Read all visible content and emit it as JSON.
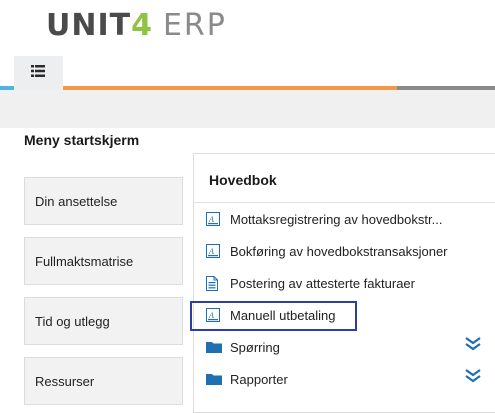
{
  "header": {
    "logo_brand": "UNIT",
    "logo_four": "4",
    "logo_product": "ERP"
  },
  "tabs": {
    "menu_icon": "list-icon"
  },
  "page": {
    "title": "Meny startskjerm"
  },
  "sidebar": {
    "items": [
      {
        "label": "Din ansettelse"
      },
      {
        "label": "Fullmaktsmatrise"
      },
      {
        "label": "Tid og utlegg"
      },
      {
        "label": "Ressurser"
      }
    ]
  },
  "card": {
    "title": "Hovedbok",
    "items": [
      {
        "label": "Mottaksregistrering av hovedbokstr...",
        "icon": "form-icon"
      },
      {
        "label": "Bokføring av hovedbokstransaksjoner",
        "icon": "form-icon"
      },
      {
        "label": "Postering av attesterte fakturaer",
        "icon": "document-icon"
      },
      {
        "label": "Manuell utbetaling",
        "icon": "form-icon"
      },
      {
        "label": "Spørring",
        "icon": "folder-icon",
        "expand_icon": "double-chevron-down-icon"
      },
      {
        "label": "Rapporter",
        "icon": "folder-icon",
        "expand_icon": "double-chevron-down-icon"
      }
    ]
  },
  "colors": {
    "accent_blue": "#4fb3e3",
    "accent_orange": "#f09a4a",
    "accent_gray": "#8a8a8a",
    "icon_blue": "#1f6fb2",
    "highlight": "#2c3e9e",
    "logo_green": "#8fc343"
  }
}
